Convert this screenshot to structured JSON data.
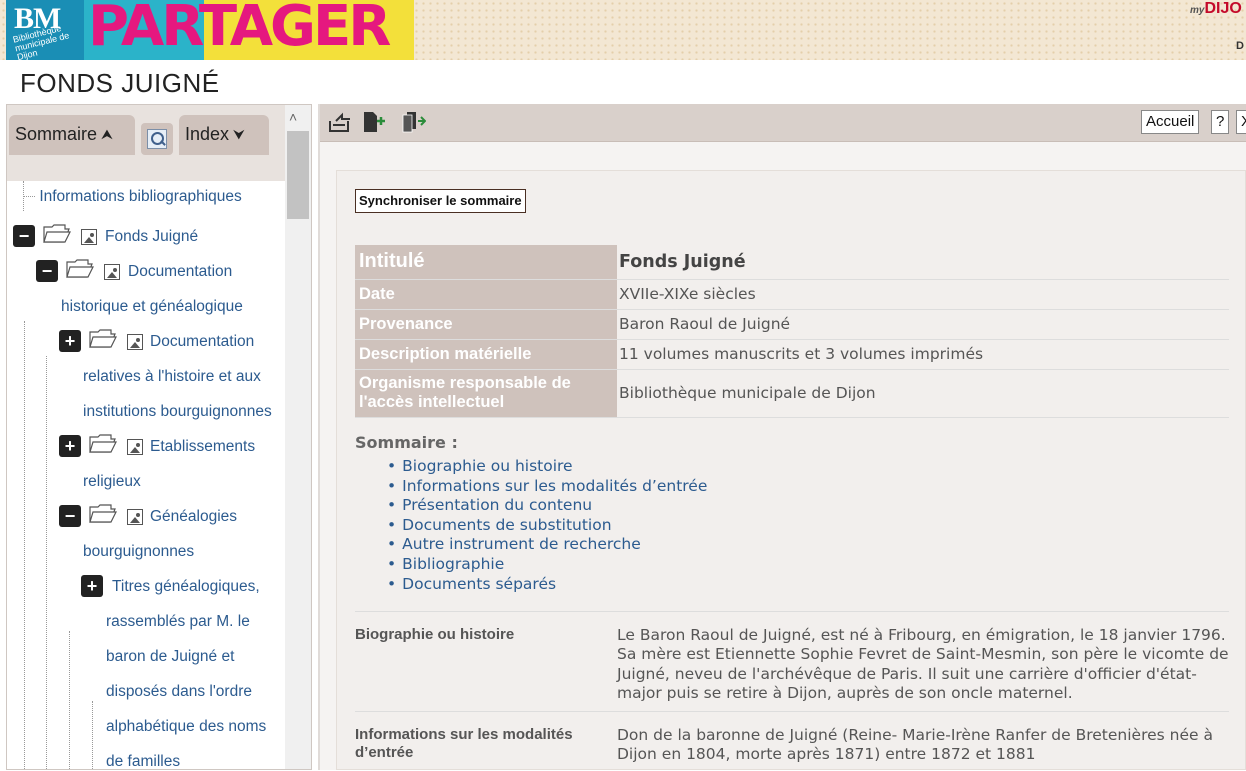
{
  "banner": {
    "logo_abbr": "BM",
    "logo_sub": "Bibliothèque municipale de Dijon",
    "partager": "PARTAGER",
    "my_dijon_my": "my",
    "my_dijon": "DIJO",
    "my_dijon_d": "D"
  },
  "page_title": "FONDS JUIGNÉ",
  "left_tabs": {
    "sommaire": "Sommaire",
    "index": "Index"
  },
  "tree": [
    {
      "label": "Informations bibliographiques"
    },
    {
      "label": "Fonds Juigné"
    },
    {
      "label_1": "Documentation",
      "label_2": "historique et généalogique"
    },
    {
      "label_1": "Documentation",
      "label_2": "relatives à l'histoire et aux",
      "label_3": "institutions bourguignonnes"
    },
    {
      "label_1": "Etablissements",
      "label_2": "religieux"
    },
    {
      "label_1": "Généalogies",
      "label_2": "bourguignonnes"
    },
    {
      "label_1": "Titres généalogiques,",
      "label_2": "rassemblés par M. le",
      "label_3": "baron de Juigné et",
      "label_4": "disposés dans l'ordre",
      "label_5": "alphabétique des noms",
      "label_6": "de familles"
    }
  ],
  "toolbar": {
    "accueil": "Accueil",
    "help": "?",
    "close": "X"
  },
  "sync_button": "Synchroniser le sommaire",
  "meta": [
    {
      "key": "Intitulé",
      "value": "Fonds Juigné"
    },
    {
      "key": "Date",
      "value": "XVIIe-XIXe siècles"
    },
    {
      "key": "Provenance",
      "value": "Baron Raoul de Juigné"
    },
    {
      "key": "Description matérielle",
      "value": "11 volumes manuscrits et 3 volumes imprimés"
    },
    {
      "key": "Organisme responsable de l'accès intellectuel",
      "value": "Bibliothèque municipale de Dijon"
    }
  ],
  "sommaire": {
    "heading": "Sommaire :",
    "items": [
      "Biographie ou histoire",
      "Informations sur les modalités d’entrée",
      "Présentation du contenu",
      "Documents de substitution",
      "Autre instrument de recherche",
      "Bibliographie",
      "Documents séparés"
    ]
  },
  "sections": [
    {
      "key": "Biographie ou histoire",
      "value": "Le Baron Raoul de Juigné, est né à Fribourg, en émigration, le 18 janvier 1796. Sa mère est Etiennette Sophie Fevret de Saint-Mesmin, son père le vicomte de Juigné, neveu de l'archévêque de Paris. Il suit une carrière d'officier d'état-major puis se retire à Dijon, auprès de son oncle maternel."
    },
    {
      "key": "Informations sur les modalités d’entrée",
      "value": "Don de la baronne de Juigné (Reine- Marie-Irène Ranfer de Bretenières née à Dijon en 1804, morte après 1871) entre 1872 et 1881"
    }
  ],
  "colors": {
    "link": "#2c5b8f",
    "label_bg": "#cfc2bc",
    "toolbar_bg": "#d9d0cb"
  },
  "icons": [
    "search-icon",
    "folder-open-icon",
    "image-icon",
    "collapse-icon",
    "expand-icon",
    "export-icon",
    "add-document-icon",
    "copy-document-icon",
    "chevron-up-icon",
    "chevron-down-icon"
  ]
}
